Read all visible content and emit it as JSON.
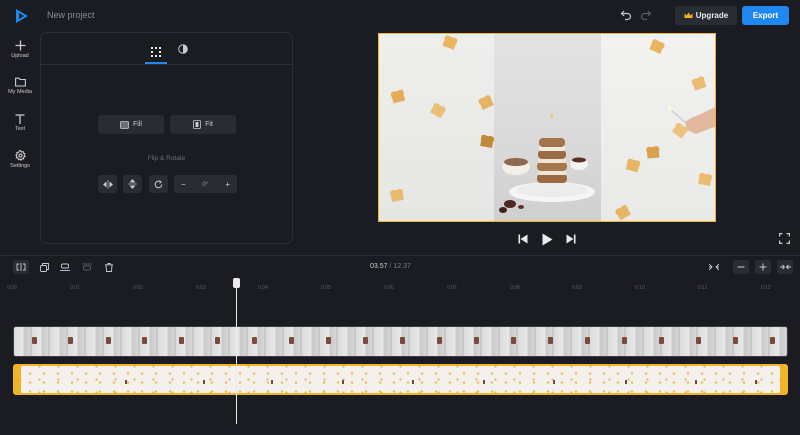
{
  "header": {
    "project_name": "New project",
    "upgrade_label": "Upgrade",
    "export_label": "Export"
  },
  "sidebar": {
    "items": [
      {
        "label": "Upload",
        "icon": "plus-icon"
      },
      {
        "label": "My Media",
        "icon": "folder-icon"
      },
      {
        "label": "Text",
        "icon": "text-icon"
      },
      {
        "label": "Settings",
        "icon": "gear-icon"
      }
    ]
  },
  "panel": {
    "tabs": [
      {
        "icon": "grid-icon",
        "active": true
      },
      {
        "icon": "adjust-icon",
        "active": false
      }
    ],
    "fill_label": "Fill",
    "fit_label": "Fit",
    "flip_heading": "Flip & Rotate",
    "rotation_value": "0°"
  },
  "player": {
    "current_time": "03.57",
    "separator": "/",
    "total_time": "12.37"
  },
  "timeline": {
    "ruler_ticks": [
      "0:00",
      "0:01",
      "0:02",
      "0:03",
      "0:04",
      "0:05",
      "0:06",
      "0:07",
      "0:08",
      "0:09",
      "0:10",
      "0:11",
      "0:12"
    ]
  },
  "colors": {
    "accent": "#1e88f0",
    "selection": "#f0b429",
    "background": "#1b1c21",
    "surface": "#2a2c33"
  }
}
